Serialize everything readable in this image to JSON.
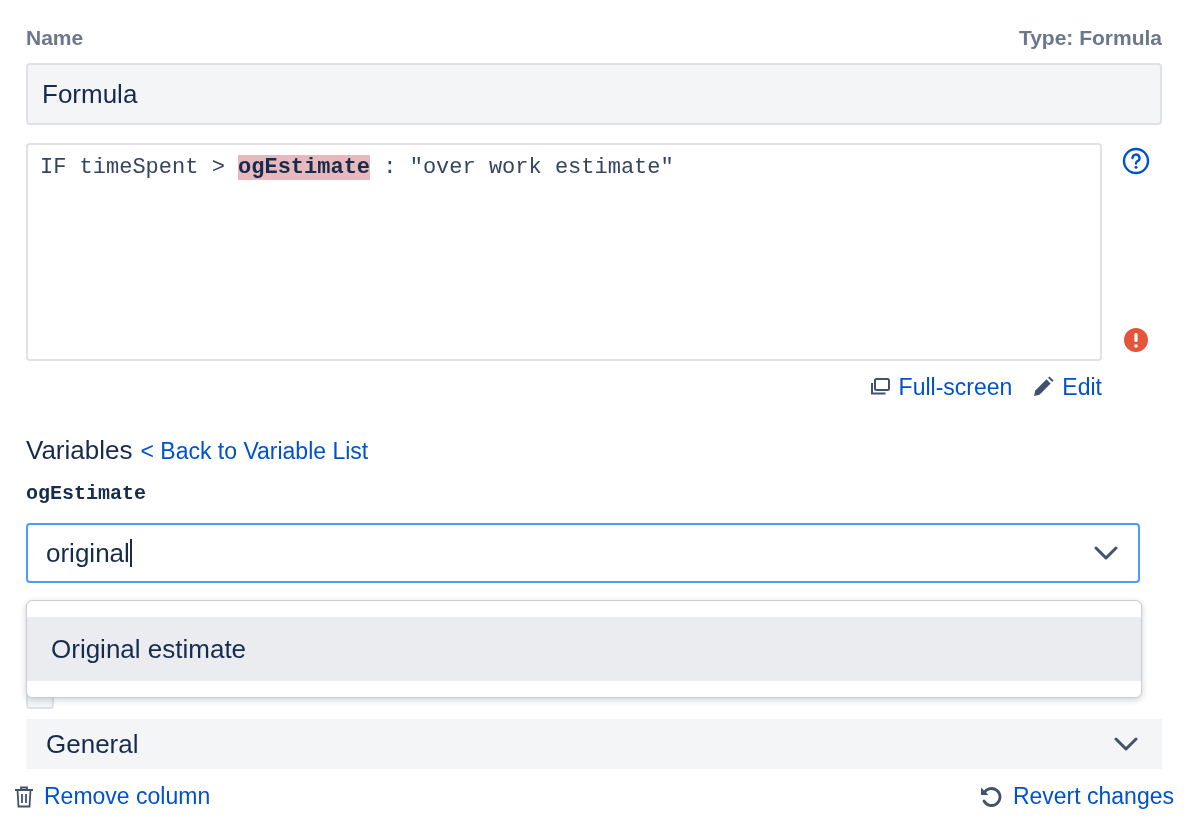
{
  "name_label": "Name",
  "type_label": "Type: Formula",
  "name_input": {
    "value": "Formula"
  },
  "formula": {
    "tokens": [
      {
        "text": "IF timeSpent > ",
        "highlighted": false
      },
      {
        "text": "ogEstimate",
        "highlighted": true
      },
      {
        "text": " : \"over work estimate\"",
        "highlighted": false
      }
    ],
    "has_error": true
  },
  "editor_actions": [
    {
      "label": "Full-screen",
      "kind": "fullscreen"
    },
    {
      "label": "Edit",
      "kind": "edit"
    }
  ],
  "variables_heading": "Variables",
  "back_link": "< Back to Variable List",
  "variable_name": "ogEstimate",
  "variable_select": {
    "value": "original",
    "open": true,
    "options": [
      {
        "label": "Original estimate",
        "selected": true
      }
    ]
  },
  "sum_checkbox": {
    "checked": false
  },
  "section": {
    "label": "General",
    "expanded": false
  },
  "footer": {
    "remove": "Remove column",
    "revert": "Revert changes"
  }
}
